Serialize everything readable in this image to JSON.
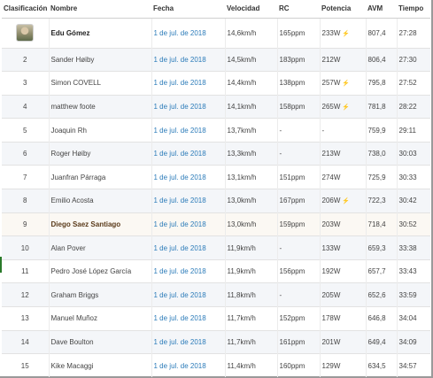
{
  "headers": {
    "rank": "Clasificación",
    "name": "Nombre",
    "date": "Fecha",
    "speed": "Velocidad",
    "hr": "RC",
    "power": "Potencia",
    "avm": "AVM",
    "time": "Tiempo"
  },
  "rows": [
    {
      "rank": "",
      "name": "Edu Gómez",
      "date": "1 de jul. de 2018",
      "speed": "14,6km/h",
      "hr": "165ppm",
      "power": "233W",
      "power_icon": "lightning-icon",
      "avm": "807,4",
      "time": "27:28"
    },
    {
      "rank": "2",
      "name": "Sander Høiby",
      "date": "1 de jul. de 2018",
      "speed": "14,5km/h",
      "hr": "183ppm",
      "power": "212W",
      "avm": "806,4",
      "time": "27:30"
    },
    {
      "rank": "3",
      "name": "Simon COVELL",
      "date": "1 de jul. de 2018",
      "speed": "14,4km/h",
      "hr": "138ppm",
      "power": "257W",
      "power_icon": "lightning-icon",
      "avm": "795,8",
      "time": "27:52"
    },
    {
      "rank": "4",
      "name": "matthew foote",
      "date": "1 de jul. de 2018",
      "speed": "14,1km/h",
      "hr": "158ppm",
      "power": "265W",
      "power_icon": "lightning-icon",
      "avm": "781,8",
      "time": "28:22"
    },
    {
      "rank": "5",
      "name": "Joaquin Rh",
      "date": "1 de jul. de 2018",
      "speed": "13,7km/h",
      "hr": "-",
      "power": "-",
      "avm": "759,9",
      "time": "29:11"
    },
    {
      "rank": "6",
      "name": "Roger Høiby",
      "date": "1 de jul. de 2018",
      "speed": "13,3km/h",
      "hr": "-",
      "power": "213W",
      "avm": "738,0",
      "time": "30:03"
    },
    {
      "rank": "7",
      "name": "Juanfran Párraga",
      "date": "1 de jul. de 2018",
      "speed": "13,1km/h",
      "hr": "151ppm",
      "power": "274W",
      "avm": "725,9",
      "time": "30:33"
    },
    {
      "rank": "8",
      "name": "Emilio Acosta",
      "date": "1 de jul. de 2018",
      "speed": "13,0km/h",
      "hr": "167ppm",
      "power": "206W",
      "power_icon": "lightning-icon",
      "avm": "722,3",
      "time": "30:42"
    },
    {
      "rank": "9",
      "name": "Diego Saez Santiago",
      "date": "1 de jul. de 2018",
      "speed": "13,0km/h",
      "hr": "159ppm",
      "power": "203W",
      "avm": "718,4",
      "time": "30:52"
    },
    {
      "rank": "10",
      "name": "Alan Pover",
      "date": "1 de jul. de 2018",
      "speed": "11,9km/h",
      "hr": "-",
      "power": "133W",
      "avm": "659,3",
      "time": "33:38"
    },
    {
      "rank": "11",
      "name": "Pedro José López García",
      "date": "1 de jul. de 2018",
      "speed": "11,9km/h",
      "hr": "156ppm",
      "power": "192W",
      "avm": "657,7",
      "time": "33:43"
    },
    {
      "rank": "12",
      "name": "Graham Briggs",
      "date": "1 de jul. de 2018",
      "speed": "11,8km/h",
      "hr": "-",
      "power": "205W",
      "avm": "652,6",
      "time": "33:59"
    },
    {
      "rank": "13",
      "name": "Manuel Muñoz",
      "date": "1 de jul. de 2018",
      "speed": "11,7km/h",
      "hr": "152ppm",
      "power": "178W",
      "avm": "646,8",
      "time": "34:04"
    },
    {
      "rank": "14",
      "name": "Dave Boulton",
      "date": "1 de jul. de 2018",
      "speed": "11,7km/h",
      "hr": "161ppm",
      "power": "201W",
      "avm": "649,4",
      "time": "34:09"
    },
    {
      "rank": "15",
      "name": "Kike Macaggi",
      "date": "1 de jul. de 2018",
      "speed": "11,4km/h",
      "hr": "160ppm",
      "power": "129W",
      "avm": "634,5",
      "time": "34:57"
    }
  ],
  "colors": {
    "date_link": "#2b7bb9",
    "row_alt": "#f4f6f9",
    "row_highlight": "#fbf8f3"
  }
}
